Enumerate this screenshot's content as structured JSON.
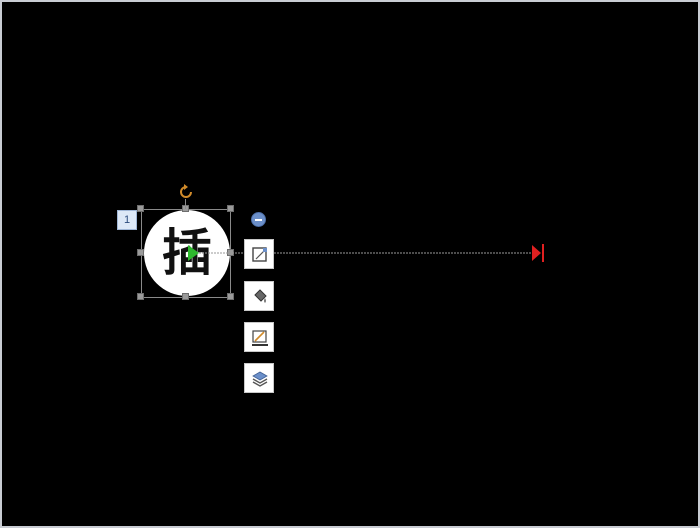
{
  "slide": {
    "background": "#000000"
  },
  "animation_badge": {
    "number": "1"
  },
  "shape": {
    "glyph": "插",
    "fill": "#ffffff"
  },
  "motion_path": {
    "start_color": "#2eb82e",
    "end_color": "#e02020",
    "line_color": "#9a9a9a"
  },
  "quick_toolbar": {
    "items": [
      {
        "icon": "minus-icon"
      },
      {
        "icon": "shape-style-icon"
      },
      {
        "icon": "fill-bucket-icon"
      },
      {
        "icon": "outline-pen-icon"
      },
      {
        "icon": "layers-icon"
      }
    ]
  }
}
